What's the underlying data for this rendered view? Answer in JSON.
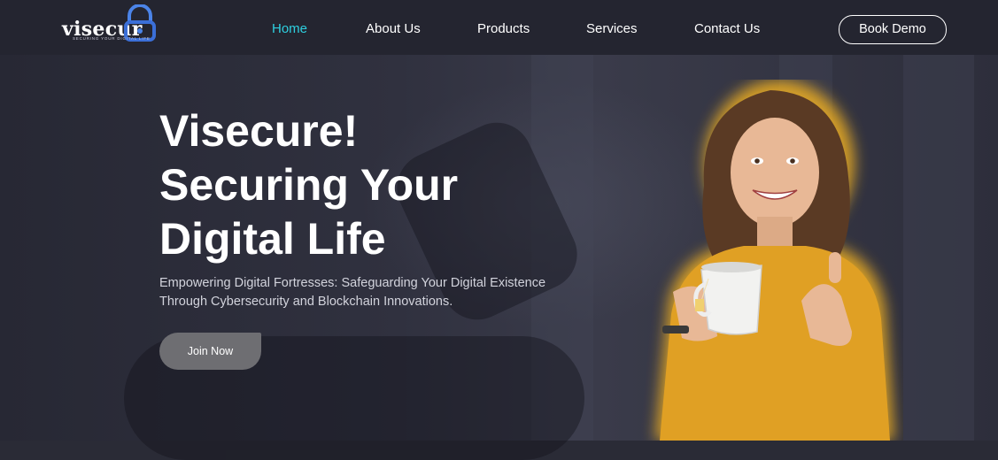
{
  "brand": {
    "name": "visecur",
    "tagline": "SECURING YOUR DIGITAL LIFE"
  },
  "nav": {
    "items": [
      {
        "label": "Home",
        "active": true
      },
      {
        "label": "About Us",
        "active": false
      },
      {
        "label": "Products",
        "active": false
      },
      {
        "label": "Services",
        "active": false
      },
      {
        "label": "Contact Us",
        "active": false
      }
    ],
    "cta_label": "Book Demo"
  },
  "hero": {
    "title_lines": [
      "Visecure!",
      "Securing Your",
      "Digital Life"
    ],
    "subtitle_lines": [
      "Empowering Digital Fortresses: Safeguarding Your Digital Existence",
      "Through Cybersecurity and Blockchain Innovations."
    ],
    "cta_label": "Join Now"
  },
  "colors": {
    "accent": "#2ed0e0",
    "logo_lock": "#3b6fd8",
    "navbar_bg": "#242530",
    "button_bg": "#6e6e72",
    "glow": "#f0b020",
    "sweater": "#e0a024"
  }
}
